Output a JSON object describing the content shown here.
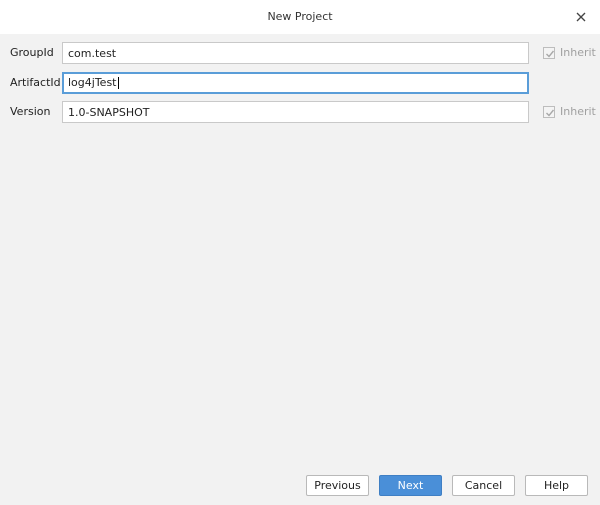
{
  "window": {
    "title": "New Project",
    "close_icon": "close-icon"
  },
  "form": {
    "group_id": {
      "label": "GroupId",
      "value": "com.test",
      "inherit_label": "Inherit",
      "inherit_checked": true,
      "inherit_enabled": false
    },
    "artifact_id": {
      "label": "ArtifactId",
      "value": "log4jTest",
      "focused": true
    },
    "version": {
      "label": "Version",
      "value": "1.0-SNAPSHOT",
      "inherit_label": "Inherit",
      "inherit_checked": true,
      "inherit_enabled": false
    }
  },
  "buttons": {
    "previous": "Previous",
    "next": "Next",
    "cancel": "Cancel",
    "help": "Help"
  },
  "colors": {
    "accent": "#4a8fd8",
    "focus_border": "#5a9dd8",
    "background": "#f2f2f2"
  }
}
